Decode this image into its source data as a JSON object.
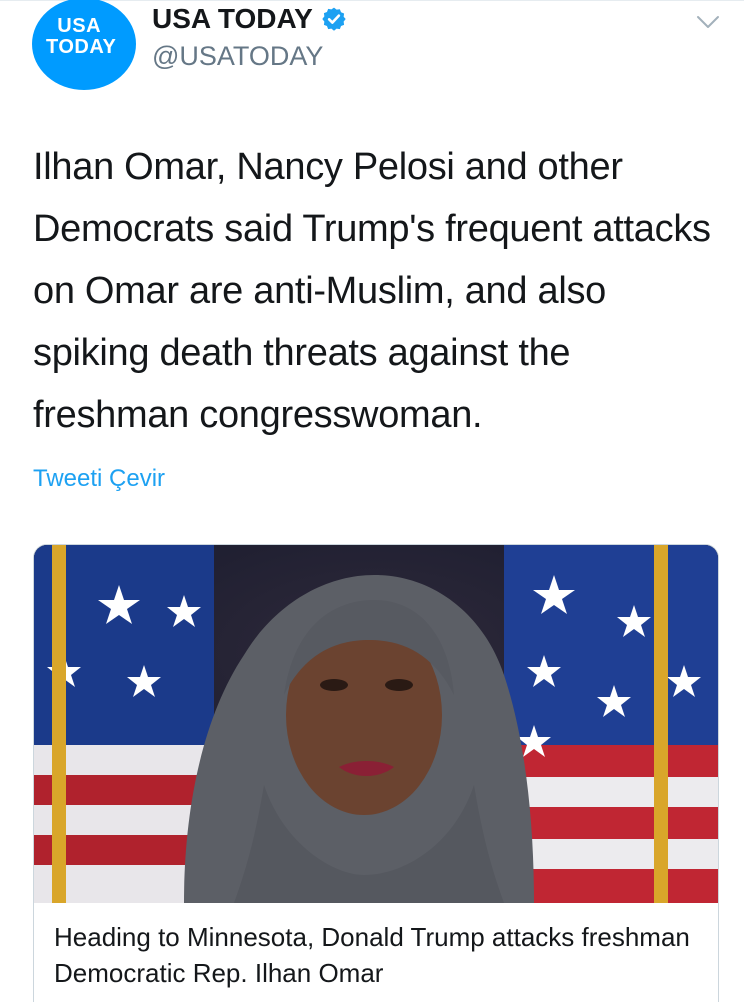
{
  "account": {
    "avatar_text_line1": "USA",
    "avatar_text_line2": "TODAY",
    "display_name": "USA TODAY",
    "handle": "@USATODAY",
    "verified": true
  },
  "tweet": {
    "text": "Ilhan Omar, Nancy Pelosi and other Democrats said Trump's frequent attacks on Omar are anti-Muslim, and also spiking death threats against the freshman congresswoman.",
    "translate_label": "Tweeti Çevir"
  },
  "card": {
    "caption": "Heading to Minnesota, Donald Trump attacks freshman Democratic Rep. Ilhan Omar"
  },
  "icons": {
    "verified": "verified-badge-icon",
    "menu": "chevron-down-icon"
  },
  "colors": {
    "brand_avatar": "#009bff",
    "link": "#1da1f2",
    "verified": "#1da1f2",
    "text": "#14171a",
    "secondary": "#657786"
  }
}
